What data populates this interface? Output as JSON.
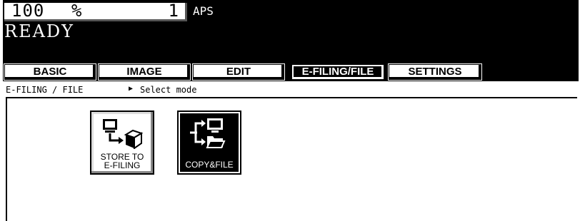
{
  "header": {
    "quantity": "100",
    "percent": "%",
    "copies": "1",
    "paper_mode": "APS",
    "status": "READY"
  },
  "tabs": [
    {
      "label": "BASIC",
      "active": false
    },
    {
      "label": "IMAGE",
      "active": false
    },
    {
      "label": "EDIT",
      "active": false
    },
    {
      "label": "E-FILING/FILE",
      "active": true
    },
    {
      "label": "SETTINGS",
      "active": false
    }
  ],
  "breadcrumb": {
    "section": "E-FILING / FILE",
    "prompt": "Select mode"
  },
  "modes": [
    {
      "line1": "STORE TO",
      "line2": "E-FILING",
      "icon": "store-to-efiling-icon",
      "style": "light"
    },
    {
      "line1": "COPY&FILE",
      "line2": "",
      "icon": "copy-and-file-icon",
      "style": "dark"
    }
  ],
  "colors": {
    "panel_bg": "#000000",
    "foreground": "#ffffff"
  }
}
